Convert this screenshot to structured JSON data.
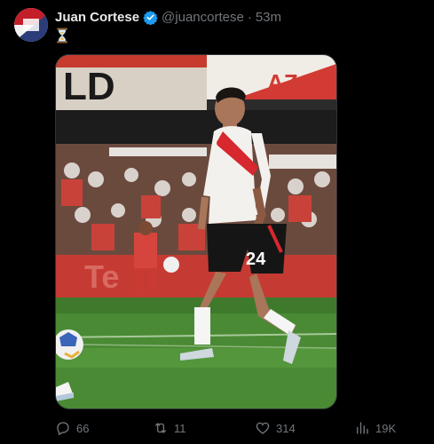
{
  "author": {
    "display_name": "Juan Cortese",
    "handle": "@juancortese",
    "separator": "·",
    "time": "53m",
    "verified": true
  },
  "tweet": {
    "emoji": "⏳"
  },
  "media": {
    "shirt_number": "24",
    "banner_text": "Te"
  },
  "actions": {
    "replies": "66",
    "retweets": "11",
    "likes": "314",
    "views": "19K"
  },
  "colors": {
    "background": "#000000",
    "primary_text": "#e7e9ea",
    "secondary_text": "#71767b",
    "verified_blue": "#1d9bf0",
    "pitch_green": "#4a8a34"
  },
  "icons": {
    "verified": "verified-badge-icon",
    "reply": "comment-bubble-icon",
    "retweet": "retweet-icon",
    "like": "heart-icon",
    "views": "bar-chart-icon"
  }
}
